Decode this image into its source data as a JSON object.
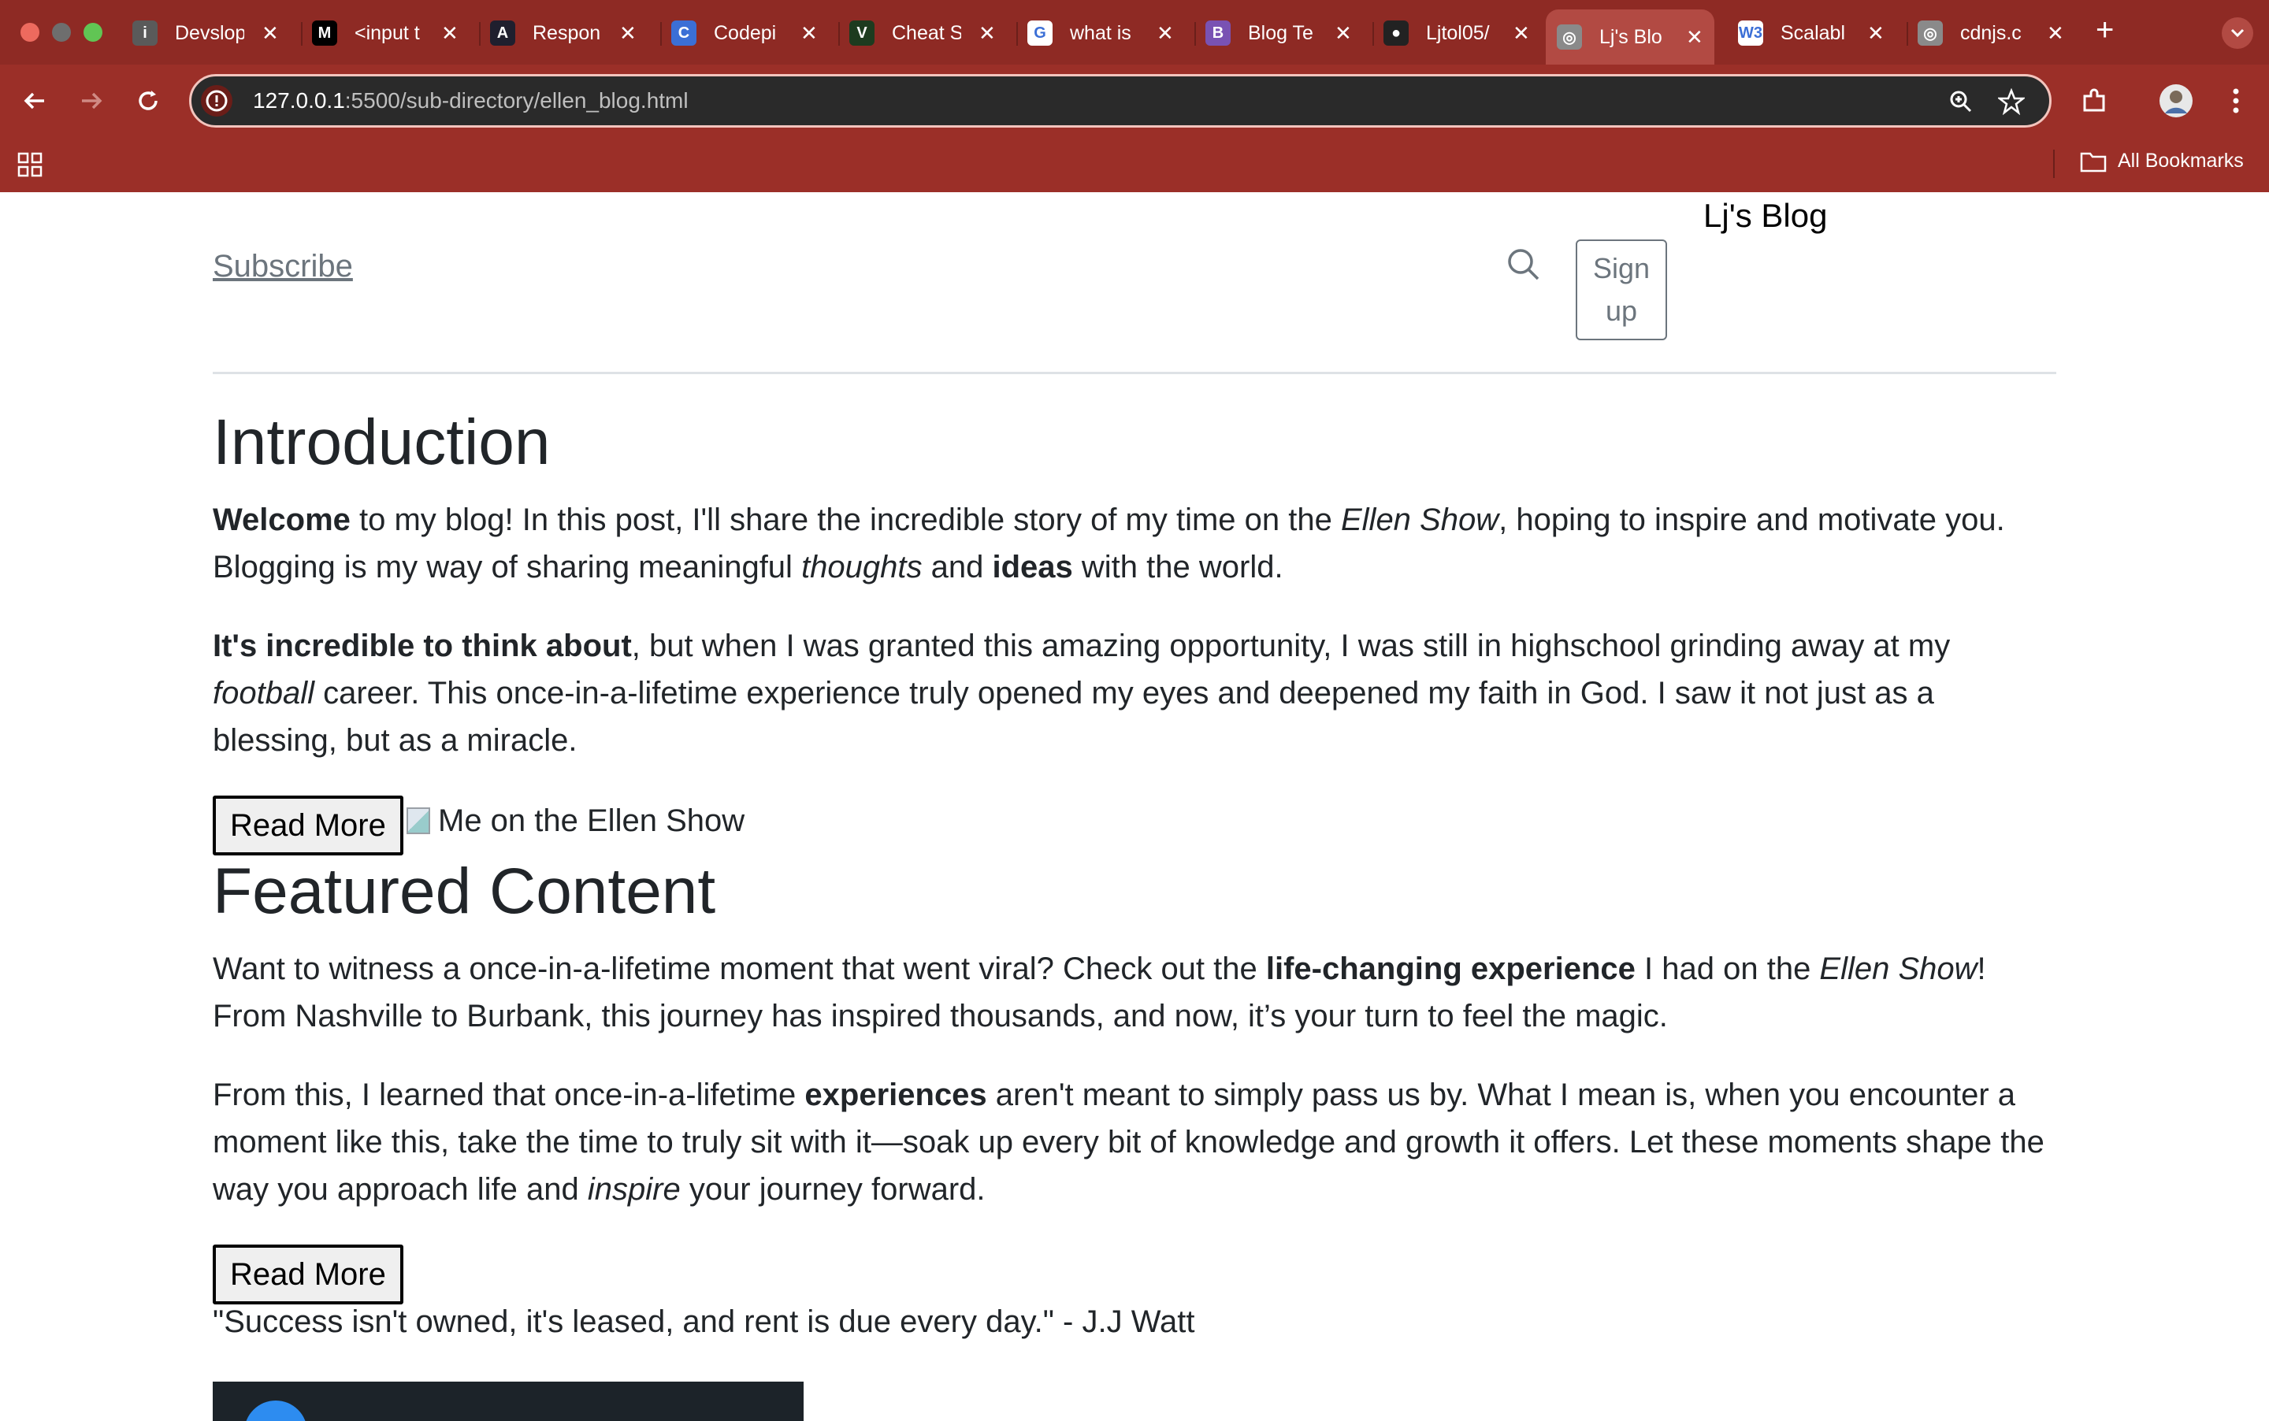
{
  "browser": {
    "tabs": [
      {
        "title": "Devslop",
        "icon": "info-icon",
        "color": "#5a5a5a",
        "glyph": "i"
      },
      {
        "title": "<input t",
        "icon": "mdn-icon",
        "color": "#000000",
        "glyph": "M"
      },
      {
        "title": "Respon",
        "icon": "angular-brackets-icon",
        "color": "#1f1f2e",
        "glyph": "A"
      },
      {
        "title": "Codepi",
        "icon": "codepip-icon",
        "color": "#3b6fd6",
        "glyph": "C"
      },
      {
        "title": "Cheat S",
        "icon": "cheat-sheet-icon",
        "color": "#1d3b1f",
        "glyph": "V"
      },
      {
        "title": "what is",
        "icon": "google-icon",
        "color": "#ffffff",
        "glyph": "G"
      },
      {
        "title": "Blog Te",
        "icon": "bootstrap-icon",
        "color": "#7952b3",
        "glyph": "B"
      },
      {
        "title": "Ljtol05/",
        "icon": "github-icon",
        "color": "#222222",
        "glyph": "●"
      },
      {
        "title": "Lj's Blo",
        "icon": "globe-icon",
        "color": "#8a8a8a",
        "glyph": "◎"
      },
      {
        "title": "Scalabl",
        "icon": "w3schools-icon",
        "color": "#ffffff",
        "glyph": "W3"
      },
      {
        "title": "cdnjs.c",
        "icon": "globe-icon",
        "color": "#8a8a8a",
        "glyph": "◎"
      }
    ],
    "active_tab_index": 8,
    "url_host": "127.0.0.1",
    "url_path": ":5500/sub-directory/ellen_blog.html",
    "bookmarks_label": "All Bookmarks",
    "chrome_color": "#9b2f28"
  },
  "header": {
    "subscribe": "Subscribe",
    "signup_line1": "Sign",
    "signup_line2": "up",
    "brand": "Lj's Blog"
  },
  "intro": {
    "heading": "Introduction",
    "p1": {
      "bold1": "Welcome",
      "t1": " to my blog! In this post, I'll share the incredible story of my time on the ",
      "italic1": "Ellen Show",
      "t2": ", hoping to inspire and motivate you. Blogging is my way of sharing meaningful ",
      "italic2": "thoughts",
      "t3": " and ",
      "bold2": "ideas",
      "t4": " with the world."
    },
    "p2": {
      "bold1": "It's incredible to think about",
      "t1": ", but when I was granted this amazing opportunity, I was still in highschool grinding away at my ",
      "italic1": "football",
      "t2": " career. This once-in-a-lifetime experience truly opened my eyes and deepened my faith in God. I saw it not just as a blessing, but as a miracle."
    },
    "read_more": "Read More",
    "image_alt": "Me on the Ellen Show"
  },
  "featured": {
    "heading": "Featured Content",
    "p1": {
      "t1": "Want to witness a once-in-a-lifetime moment that went viral? Check out the ",
      "bold1": "life-changing experience",
      "t2": " I had on the ",
      "italic1": "Ellen Show",
      "t3": "! From Nashville to Burbank, this journey has inspired thousands, and now, it’s your turn to feel the magic."
    },
    "p2": {
      "t1": "From this, I learned that once-in-a-lifetime ",
      "bold1": "experiences",
      "t2": " aren't meant to simply pass us by. What I mean is, when you encounter a moment like this, take the time to truly sit with it—soak up every bit of knowledge and growth it offers. Let these moments shape the way you approach life and ",
      "italic1": "inspire",
      "t3": " your journey forward."
    },
    "read_more": "Read More",
    "quote": "\"Success isn't owned, it's leased, and rent is due every day.\" - J.J Watt"
  }
}
